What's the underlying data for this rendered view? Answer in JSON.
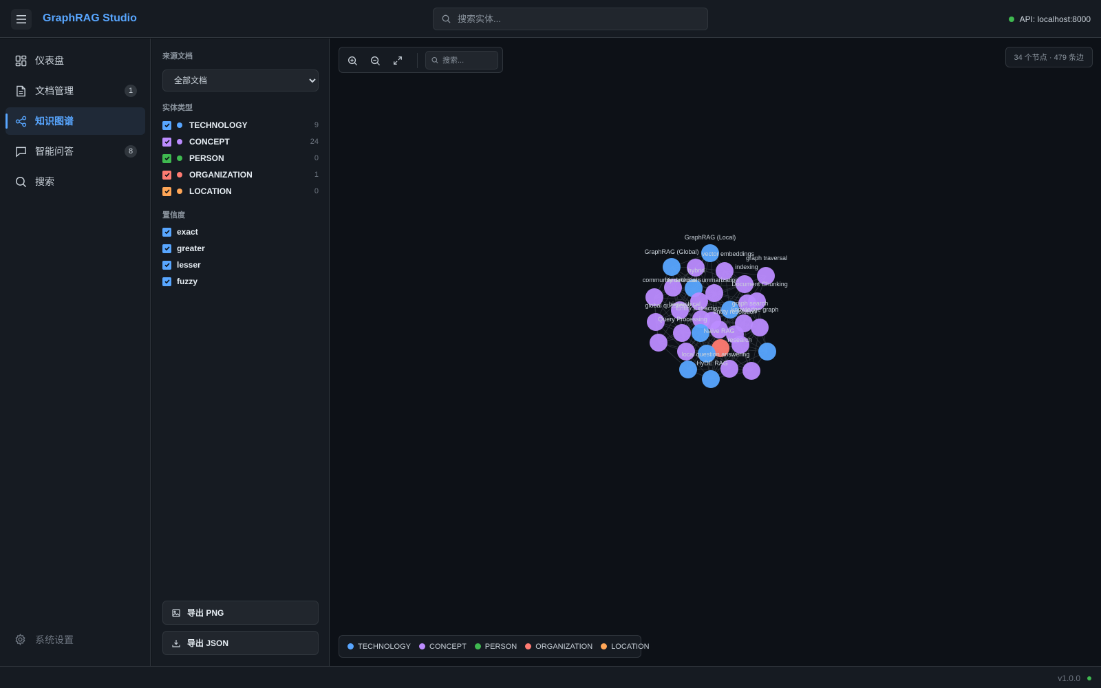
{
  "header": {
    "title": "GraphRAG Studio",
    "search_placeholder": "搜索实体...",
    "api_status": "API: localhost:8000"
  },
  "nav": {
    "items": [
      {
        "label": "仪表盘",
        "icon": "dashboard-icon"
      },
      {
        "label": "文档管理",
        "icon": "document-icon",
        "badge": "1"
      },
      {
        "label": "知识图谱",
        "icon": "share-graph-icon",
        "active": true
      },
      {
        "label": "智能问答",
        "icon": "chat-icon",
        "badge": "8"
      },
      {
        "label": "搜索",
        "icon": "search-icon"
      }
    ],
    "settings_label": "系统设置"
  },
  "filters": {
    "source_label": "来源文档",
    "source_value": "全部文档",
    "entity_type_label": "实体类型",
    "entity_types": [
      {
        "name": "TECHNOLOGY",
        "count": "9",
        "color": "#58a6ff"
      },
      {
        "name": "CONCEPT",
        "count": "24",
        "color": "#bc8cff"
      },
      {
        "name": "PERSON",
        "count": "0",
        "color": "#3fb950"
      },
      {
        "name": "ORGANIZATION",
        "count": "1",
        "color": "#ff7b72"
      },
      {
        "name": "LOCATION",
        "count": "0",
        "color": "#ffa657"
      }
    ],
    "confidence_label": "置信度",
    "confidence": [
      "exact",
      "greater",
      "lesser",
      "fuzzy"
    ],
    "export_png": "导出 PNG",
    "export_json": "导出 JSON"
  },
  "graph": {
    "search_placeholder": "搜索...",
    "stats": "34 个节点 · 479 条边",
    "legend": [
      {
        "name": "TECHNOLOGY",
        "color": "#58a6ff"
      },
      {
        "name": "CONCEPT",
        "color": "#bc8cff"
      },
      {
        "name": "PERSON",
        "color": "#3fb950"
      },
      {
        "name": "ORGANIZATION",
        "color": "#ff7b72"
      },
      {
        "name": "LOCATION",
        "color": "#ffa657"
      }
    ],
    "node_labels": [
      "GraphRAG (Local)",
      "GraphRAG (Global)",
      "vector embeddings",
      "graph traversal",
      "indexing",
      "hybrid",
      "community detection",
      "hierarchical summarization",
      "Document Chunking",
      "Entity Extraction",
      "global questions",
      "hierarchical",
      "graph search",
      "knowledge graph",
      "entity resolution",
      "Query Processing",
      "Naive RAG",
      "research",
      "local question answering",
      "HyDE RAG"
    ]
  },
  "footer": {
    "version": "v1.0.0"
  }
}
